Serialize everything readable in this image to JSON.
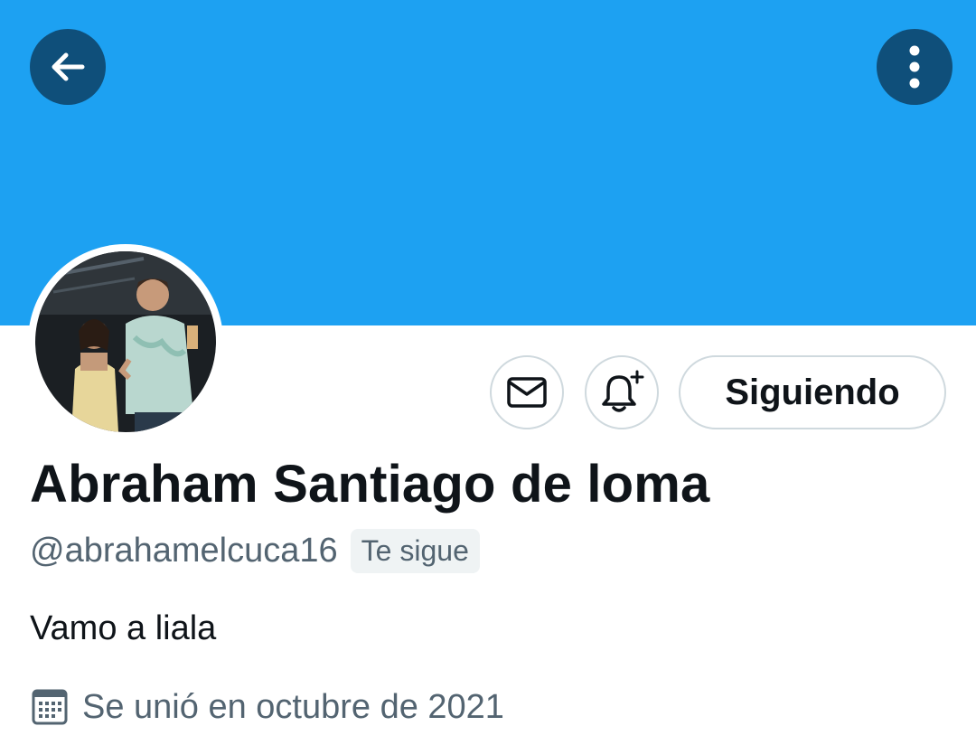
{
  "header": {
    "back_icon": "arrow-left-icon",
    "more_icon": "vertical-dots-icon",
    "banner_color": "#1da1f2"
  },
  "actions": {
    "message_icon": "envelope-icon",
    "notify_icon": "bell-plus-icon",
    "follow_label": "Siguiendo"
  },
  "profile": {
    "name": "Abraham Santiago de loma",
    "handle": "@abrahamelcuca16",
    "follows_you": "Te sigue",
    "bio": "Vamo a liala",
    "joined": "Se unió en octubre de 2021",
    "joined_icon": "calendar-icon"
  },
  "colors": {
    "primary_text": "#0f1419",
    "secondary_text": "#536471",
    "border": "#cfd9de"
  }
}
